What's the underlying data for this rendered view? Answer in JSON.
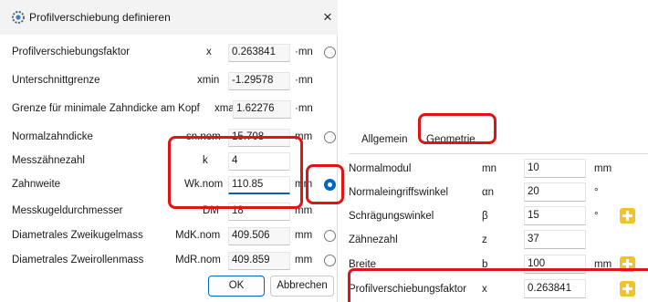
{
  "dialog": {
    "title": "Profilverschiebung definieren",
    "close_glyph": "×",
    "rows": [
      {
        "label": "Profilverschiebungsfaktor",
        "symbol": "x",
        "value": "0.263841",
        "unit": "·mn",
        "radio": "off"
      },
      {
        "label": "Unterschnittgrenze",
        "symbol": "xmin",
        "value": "-1.29578",
        "unit": "·mn",
        "radio": "none"
      },
      {
        "label": "Grenze für minimale Zahndicke am Kopf",
        "symbol": "xma",
        "value": "1.62276",
        "unit": "·mn",
        "radio": "none"
      },
      {
        "label": "Normalzahndicke",
        "symbol": "sn.nom",
        "value": "15.708",
        "unit": "mm",
        "radio": "off"
      },
      {
        "label": "Messzähnezahl",
        "symbol": "k",
        "value": "4",
        "unit": "",
        "radio": "none"
      },
      {
        "label": "Zahnweite",
        "symbol": "Wk.nom",
        "value": "110.85",
        "unit": "mm",
        "radio": "on"
      },
      {
        "label": "Messkugeldurchmesser",
        "symbol": "DM",
        "value": "18",
        "unit": "mm",
        "radio": "none"
      },
      {
        "label": "Diametrales Zweikugelmass",
        "symbol": "MdK.nom",
        "value": "409.506",
        "unit": "mm",
        "radio": "off"
      },
      {
        "label": "Diametrales Zweirollenmass",
        "symbol": "MdR.nom",
        "value": "409.859",
        "unit": "mm",
        "radio": "off"
      }
    ],
    "ok_label": "OK",
    "cancel_label": "Abbrechen"
  },
  "panel": {
    "tabs": [
      "Allgemein",
      "Geometrie"
    ],
    "active_tab": "Geometrie",
    "rows": [
      {
        "label": "Normalmodul",
        "symbol": "mn",
        "value": "10",
        "unit": "mm",
        "plus": false
      },
      {
        "label": "Normaleingriffswinkel",
        "symbol": "αn",
        "value": "20",
        "unit": "°",
        "plus": false
      },
      {
        "label": "Schrägungswinkel",
        "symbol": "β",
        "value": "15",
        "unit": "°",
        "plus": true
      },
      {
        "label": "Zähnezahl",
        "symbol": "z",
        "value": "37",
        "unit": "",
        "plus": false
      },
      {
        "label": "Breite",
        "symbol": "b",
        "value": "100",
        "unit": "mm",
        "plus": true
      },
      {
        "label": "Profilverschiebungsfaktor",
        "symbol": "x",
        "value": "0.263841",
        "unit": "",
        "plus": true
      }
    ]
  },
  "colors": {
    "highlight": "#e01414",
    "accent": "#0067c0",
    "plus_button": "#f6c02a"
  },
  "icons": {
    "app": "gear-app-icon",
    "close": "close-icon",
    "plus": "plus-icon"
  }
}
